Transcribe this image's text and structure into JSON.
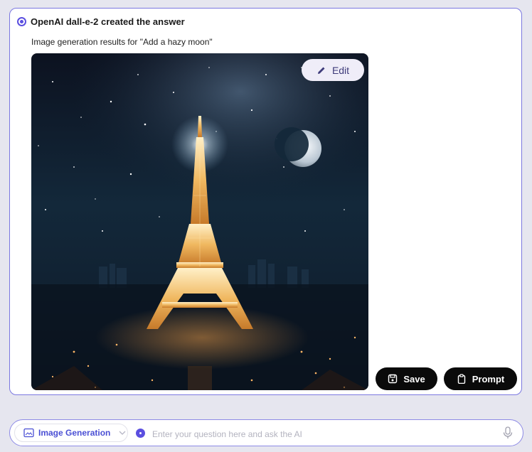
{
  "response": {
    "title": "OpenAI dall-e-2 created the answer",
    "subtitle": "Image generation results for \"Add a hazy moon\"",
    "image_alt": "Eiffel Tower at night under starry sky with a hazy crescent moon",
    "edit_label": "Edit",
    "save_label": "Save",
    "prompt_label": "Prompt"
  },
  "input_bar": {
    "mode_label": "Image Generation",
    "placeholder": "Enter your question here and ask the AI"
  },
  "colors": {
    "accent": "#5b4fe0",
    "card_border": "#7b78e0",
    "background": "#e6e6ef"
  },
  "icons": [
    "radio-icon",
    "pencil-icon",
    "save-icon",
    "clipboard-icon",
    "image-icon",
    "chevron-down-icon",
    "mic-icon"
  ]
}
